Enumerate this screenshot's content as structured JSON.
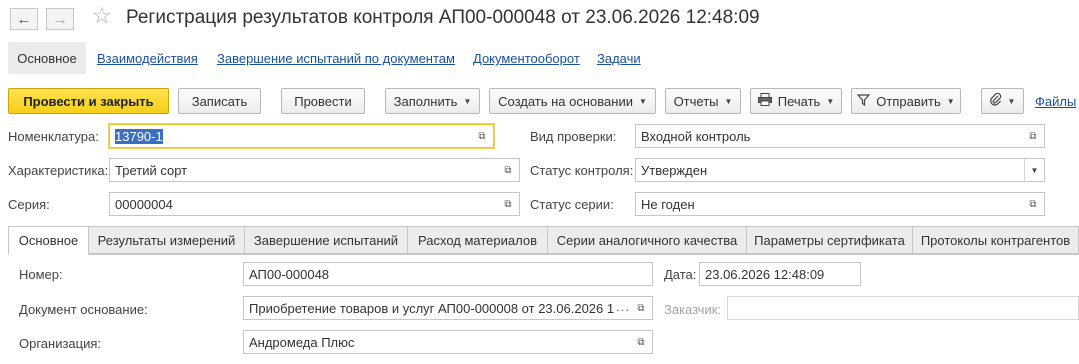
{
  "header": {
    "title": "Регистрация результатов контроля АП00-000048 от 23.06.2026 12:48:09",
    "back_icon": "←",
    "forward_icon": "→",
    "favorite_icon": "☆"
  },
  "sections": {
    "active": "Основное",
    "links": [
      "Взаимодействия",
      "Завершение испытаний по документам",
      "Документооборот",
      "Задачи"
    ]
  },
  "toolbar": {
    "post_close": "Провести и закрыть",
    "write": "Записать",
    "post": "Провести",
    "fill": "Заполнить",
    "create_based": "Создать на основании",
    "reports": "Отчеты",
    "print": "Печать",
    "send": "Отправить",
    "files": "Файлы"
  },
  "fields": {
    "nomenclature": {
      "label": "Номенклатура:",
      "value": "13790-1"
    },
    "characteristic": {
      "label": "Характеристика:",
      "value": "Третий сорт"
    },
    "series": {
      "label": "Серия:",
      "value": "00000004"
    },
    "check_type": {
      "label": "Вид проверки:",
      "value": "Входной контроль"
    },
    "control_status": {
      "label": "Статус контроля:",
      "value": "Утвержден"
    },
    "series_status": {
      "label": "Статус серии:",
      "value": "Не годен"
    }
  },
  "tabs": [
    "Основное",
    "Результаты измерений",
    "Завершение испытаний",
    "Расход материалов",
    "Серии аналогичного качества",
    "Параметры сертификата",
    "Протоколы контрагентов"
  ],
  "main_tab": {
    "number": {
      "label": "Номер:",
      "value": "АП00-000048"
    },
    "date": {
      "label": "Дата:",
      "value": "23.06.2026 12:48:09"
    },
    "base_doc": {
      "label": "Документ основание:",
      "value": "Приобретение товаров и услуг АП00-000008 от 23.06.2026 1"
    },
    "customer": {
      "label": "Заказчик:",
      "value": ""
    },
    "organization": {
      "label": "Организация:",
      "value": "Андромеда Плюс"
    }
  },
  "colors": {
    "primary_button": "#f6cd1a",
    "link": "#1a4f9c",
    "selection": "#3a6fc4",
    "focus_border": "#f0c419"
  }
}
